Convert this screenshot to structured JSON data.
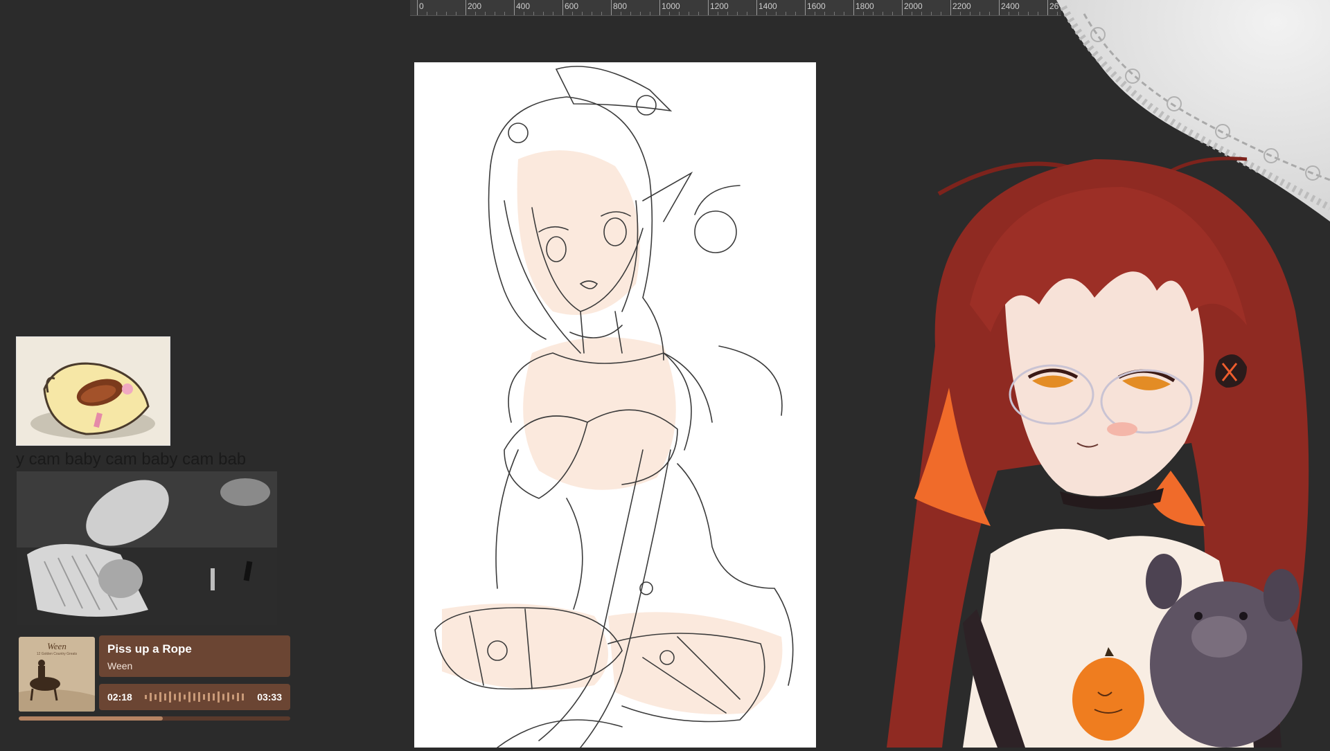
{
  "ruler": {
    "labels": [
      "0",
      "200",
      "400",
      "600",
      "800",
      "1000",
      "1200",
      "1400",
      "1600",
      "1800",
      "2000",
      "2200",
      "2400",
      "26"
    ]
  },
  "marquee": {
    "text": "y cam baby cam baby cam bab"
  },
  "now_playing": {
    "album_title": "Ween",
    "album_subtitle": "12 Golden Country Greats",
    "track_title": "Piss up a Rope",
    "artist": "Ween",
    "elapsed": "02:18",
    "duration": "03:33",
    "progress": 0.53
  },
  "colors": {
    "background": "#2b2b2b",
    "panel": "#6b4533",
    "progress": "#b58463",
    "hair": "#8f2a22",
    "skin_flat": "#fbe9dd"
  },
  "icons": {
    "lace": "lace-doily-decoration",
    "bug": "cockroach-sticker",
    "pumpkin": "pumpkin-head-icon",
    "plush": "teddy-plush-icon"
  }
}
